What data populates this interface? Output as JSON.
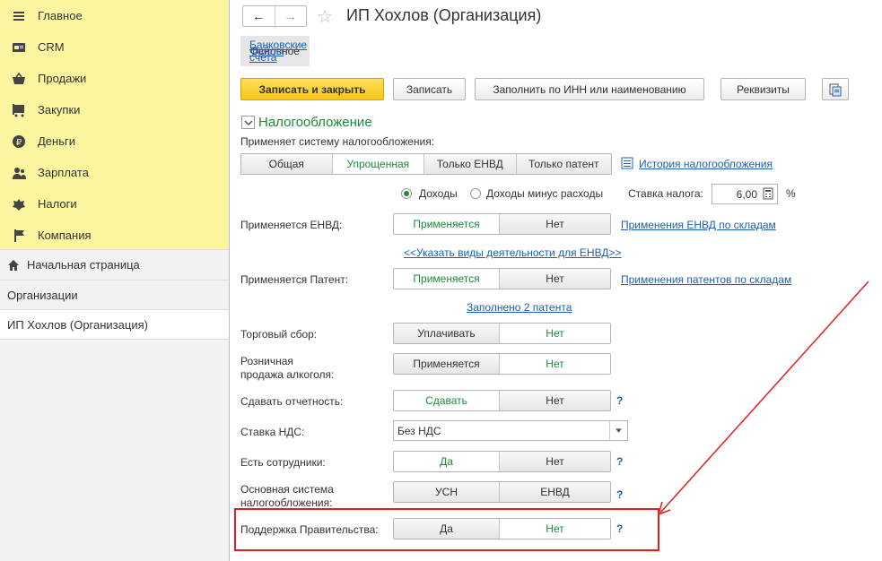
{
  "sidebar": {
    "nav": [
      {
        "label": "Главное",
        "icon": "menu-icon"
      },
      {
        "label": "CRM",
        "icon": "crm-icon"
      },
      {
        "label": "Продажи",
        "icon": "basket-icon"
      },
      {
        "label": "Закупки",
        "icon": "cart-icon"
      },
      {
        "label": "Деньги",
        "icon": "money-icon"
      },
      {
        "label": "Зарплата",
        "icon": "people-icon"
      },
      {
        "label": "Налоги",
        "icon": "emblem-icon"
      },
      {
        "label": "Компания",
        "icon": "flag-icon"
      }
    ],
    "home": "Начальная страница",
    "orgs": "Организации",
    "current": "ИП Хохлов (Организация)"
  },
  "header": {
    "back": "←",
    "forward": "→",
    "star": "☆",
    "title": "ИП Хохлов (Организация)"
  },
  "tabs": [
    "Основное",
    "Банковские счета",
    "Файлы"
  ],
  "toolbar": {
    "save_close": "Записать и закрыть",
    "save": "Записать",
    "fill": "Заполнить по ИНН или наименованию",
    "requisites": "Реквизиты"
  },
  "tax": {
    "section_title": "Налогообложение",
    "system_label": "Применяет систему налогообложения:",
    "systems": [
      "Общая",
      "Упрощенная",
      "Только ЕНВД",
      "Только патент"
    ],
    "selected_system": "Упрощенная",
    "history_link": "История налогообложения",
    "income": "Доходы",
    "income_minus": "Доходы минус расходы",
    "rate_label": "Ставка налога:",
    "rate_value": "6,00",
    "rate_unit": "%"
  },
  "rows": {
    "envd_label": "Применяется ЕНВД:",
    "envd_opts": [
      "Применяется",
      "Нет"
    ],
    "envd_link": "Применения ЕНВД по складам",
    "envd_activity_link": "<<Указать виды деятельности для ЕНВД>>",
    "patent_label": "Применяется Патент:",
    "patent_opts": [
      "Применяется",
      "Нет"
    ],
    "patent_link": "Применения патентов по складам",
    "patent_filled_link": "Заполнено 2 патента",
    "trade_label": "Торговый сбор:",
    "trade_opts": [
      "Уплачивать",
      "Нет"
    ],
    "alcohol_label_1": "Розничная",
    "alcohol_label_2": "продажа алкоголя:",
    "alcohol_opts": [
      "Применяется",
      "Нет"
    ],
    "report_label": "Сдавать отчетность:",
    "report_opts": [
      "Сдавать",
      "Нет"
    ],
    "vat_label": "Ставка НДС:",
    "vat_value": "Без НДС",
    "staff_label": "Есть сотрудники:",
    "staff_opts": [
      "Да",
      "Нет"
    ],
    "main_sys_label_1": "Основная система",
    "main_sys_label_2": "налогообложения:",
    "main_sys_opts": [
      "УСН",
      "ЕНВД"
    ],
    "gov_label": "Поддержка Правительства:",
    "gov_opts": [
      "Да",
      "Нет"
    ],
    "help": "?"
  }
}
